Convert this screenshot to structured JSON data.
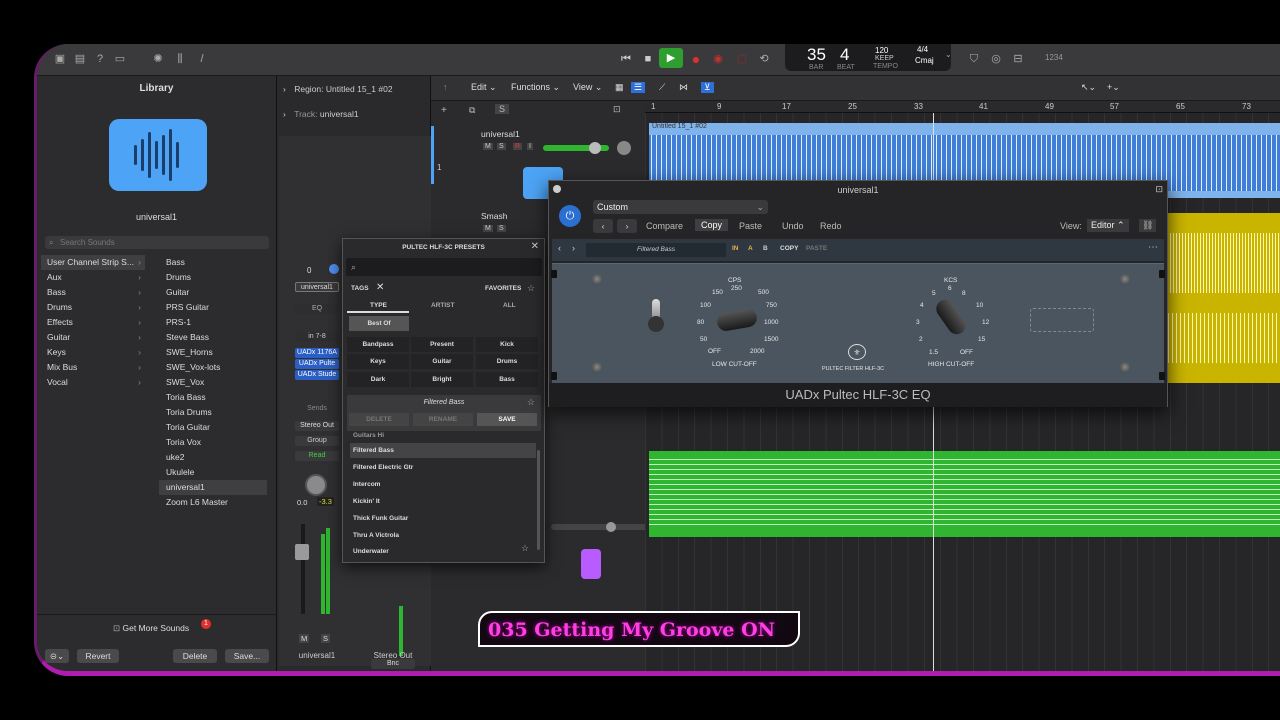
{
  "transport": {
    "bar": "35",
    "beat": "4",
    "bar_label": "BAR",
    "beat_label": "BEAT",
    "tempo": "120",
    "tempo_mode": "KEEP",
    "tempo_label": "TEMPO",
    "time_sig": "4/4",
    "key": "Cmaj",
    "count": "1234"
  },
  "library": {
    "title": "Library",
    "patch_name": "universal1",
    "search_placeholder": "Search Sounds",
    "categories": [
      "User Channel Strip S...",
      "Aux",
      "Bass",
      "Drums",
      "Effects",
      "Guitar",
      "Keys",
      "Mix Bus",
      "Vocal"
    ],
    "items": [
      "Bass",
      "Drums",
      "Guitar",
      "PRS Guitar",
      "PRS-1",
      "Steve Bass",
      "SWE_Horns",
      "SWE_Vox-lots",
      "SWE_Vox",
      "Toria Bass",
      "Toria Drums",
      "Toria Guitar",
      "Toria Vox",
      "uke2",
      "Ukulele",
      "universal1",
      "Zoom L6 Master"
    ],
    "get_more": "Get More Sounds",
    "badge": "1",
    "revert": "Revert",
    "delete": "Delete",
    "save": "Save..."
  },
  "inspector": {
    "region_label": "Region:",
    "region_name": "Untitled 15_1 #02",
    "track_label": "Track:",
    "track_name": "universal1",
    "strip1": {
      "value": "0",
      "setting": "universal1",
      "eq": "EQ",
      "input": "in 7-8",
      "plugins": [
        "UADx 1176A",
        "UADx Pulte",
        "UADx Stude"
      ],
      "sends": "Sends",
      "output": "Stereo Out",
      "group": "Group",
      "automation": "Read",
      "vol": "0.0",
      "peak": "-3.3",
      "m": "M",
      "s": "S",
      "name": "universal1"
    },
    "strip2": {
      "bnc": "Bnc",
      "m": "M",
      "s": "S",
      "name": "Stereo Out"
    }
  },
  "main": {
    "edit": "Edit",
    "functions": "Functions",
    "view": "View",
    "ruler": [
      "1",
      "9",
      "17",
      "25",
      "33",
      "41",
      "49",
      "57",
      "65",
      "73"
    ],
    "track_number": "1",
    "tracks": [
      {
        "name": "universal1",
        "m": "M",
        "s": "S",
        "r": "R",
        "i": "I"
      },
      {
        "name": "Smash",
        "m": "M",
        "s": "S"
      }
    ],
    "region_name": "Untitled 15_1 #02"
  },
  "presets": {
    "title": "PULTEC HLF-3C PRESETS",
    "tags": "TAGS",
    "favorites": "FAVORITES",
    "tabs": [
      "TYPE",
      "ARTIST",
      "ALL"
    ],
    "best_of": "Best Of",
    "tag_buttons": [
      "Bandpass",
      "Present",
      "Kick",
      "Keys",
      "Guitar",
      "Drums",
      "Dark",
      "Bright",
      "Bass"
    ],
    "current": "Filtered Bass",
    "delete": "DELETE",
    "rename": "RENAME",
    "save": "SAVE",
    "list": [
      "Guitars Hi",
      "Filtered Bass",
      "Filtered Electric Gtr",
      "Intercom",
      "Kickin' It",
      "Thick Funk Guitar",
      "Thru A Victrola",
      "Underwater"
    ]
  },
  "plugin": {
    "title": "universal1",
    "preset": "Custom",
    "compare": "Compare",
    "copy": "Copy",
    "paste": "Paste",
    "undo": "Undo",
    "redo": "Redo",
    "view_label": "View:",
    "view_value": "Editor",
    "uad_preset": "Filtered Bass",
    "in": "IN",
    "a": "A",
    "b": "B",
    "uad_copy": "COPY",
    "uad_paste": "PASTE",
    "cps": "CPS",
    "cps_values": [
      "150",
      "250",
      "500",
      "100",
      "750",
      "80",
      "1000",
      "50",
      "1500",
      "OFF",
      "2000"
    ],
    "low_cutoff": "LOW CUT-OFF",
    "model_label": "PULTEC FILTER HLF-3C",
    "kcs": "KCS",
    "kcs_values": [
      "5",
      "6",
      "4",
      "8",
      "10",
      "3",
      "12",
      "2",
      "15",
      "1.5",
      "OFF"
    ],
    "high_cutoff": "HIGH CUT-OFF",
    "footer": "UADx Pultec HLF-3C EQ"
  },
  "overlay_title": "035 Getting My Groove ON",
  "colors": {
    "accent": "#4da3f5",
    "yellow": "#c9b400",
    "green": "#2fb52f",
    "blue": "#3f7fd8",
    "magenta": "#ff3fe0"
  }
}
